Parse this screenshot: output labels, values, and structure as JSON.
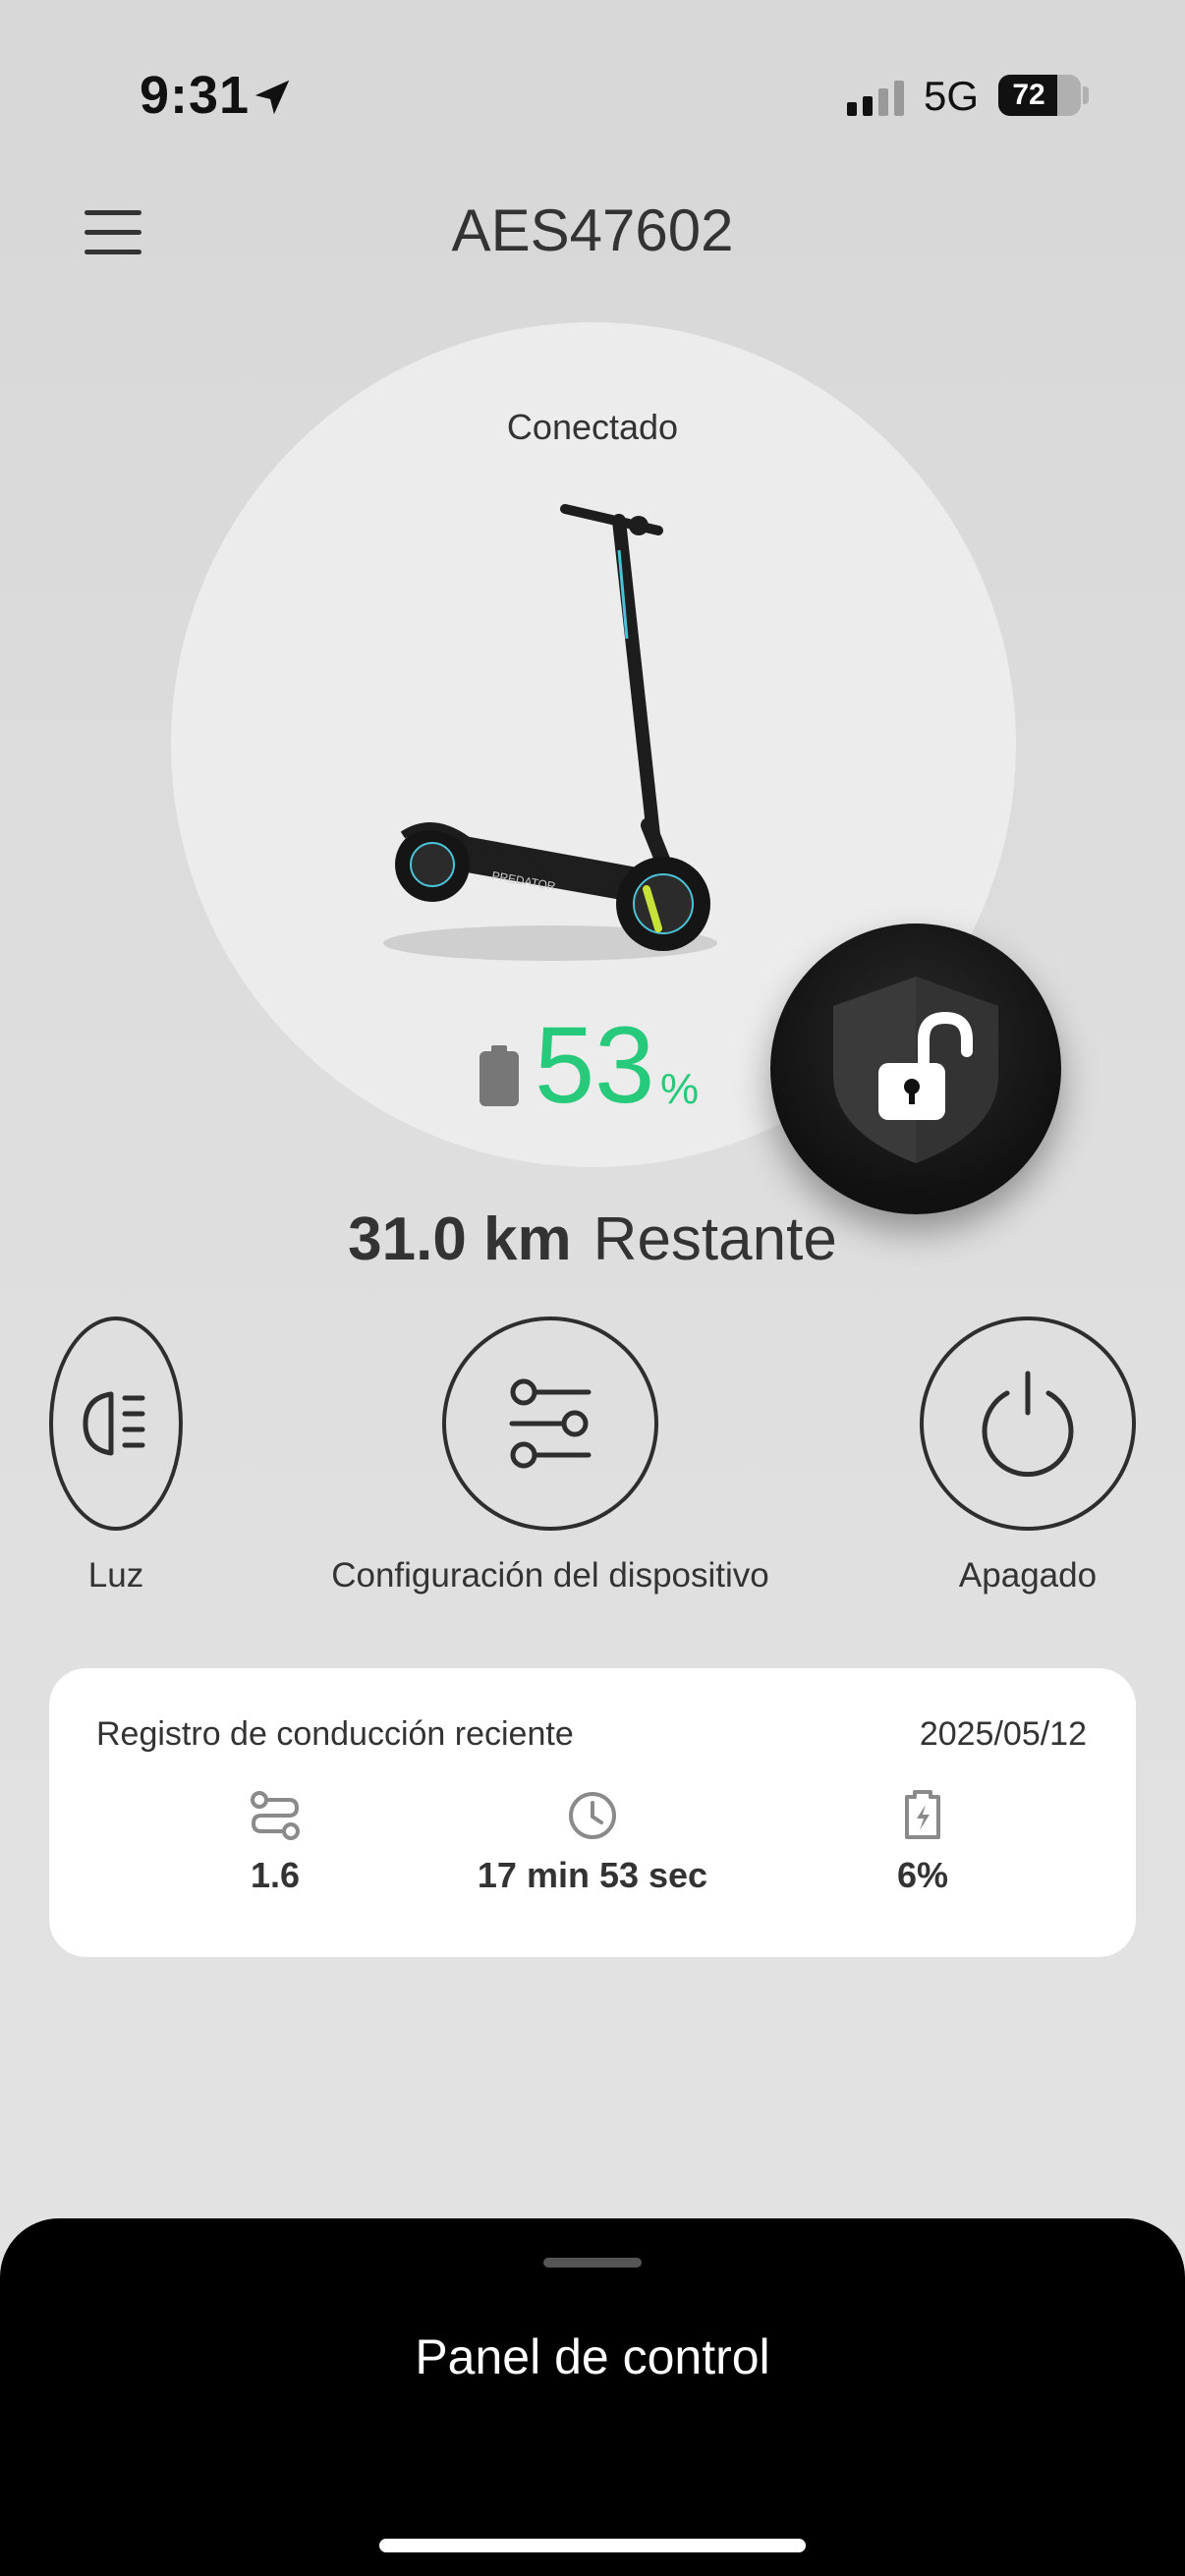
{
  "status_bar": {
    "time": "9:31",
    "network": "5G",
    "battery_percent": "72",
    "battery_level": 0.72,
    "icons": [
      "location-arrow-icon",
      "cellular-signal-icon",
      "battery-icon"
    ]
  },
  "header": {
    "title": "AES47602",
    "menu_icon": "hamburger-menu-icon"
  },
  "scooter": {
    "connection_status": "Conectado",
    "battery_value": "53",
    "battery_unit": "%",
    "battery_color": "#27c97b",
    "lock_state_icon": "unlocked-shield-icon",
    "range_value": "31.0 km",
    "range_label": "Restante"
  },
  "controls": [
    {
      "id": "light",
      "label": "Luz",
      "icon": "headlight-icon"
    },
    {
      "id": "config",
      "label": "Configuración del dispositivo",
      "icon": "sliders-icon"
    },
    {
      "id": "power",
      "label": "Apagado",
      "icon": "power-icon"
    }
  ],
  "recent_ride": {
    "title": "Registro de conducción reciente",
    "date": "2025/05/12",
    "stats": [
      {
        "icon": "route-icon",
        "value": "1.6"
      },
      {
        "icon": "clock-icon",
        "value": "17 min 53 sec"
      },
      {
        "icon": "battery-charge-icon",
        "value": "6%"
      }
    ]
  },
  "bottom_panel": {
    "title": "Panel de control"
  }
}
